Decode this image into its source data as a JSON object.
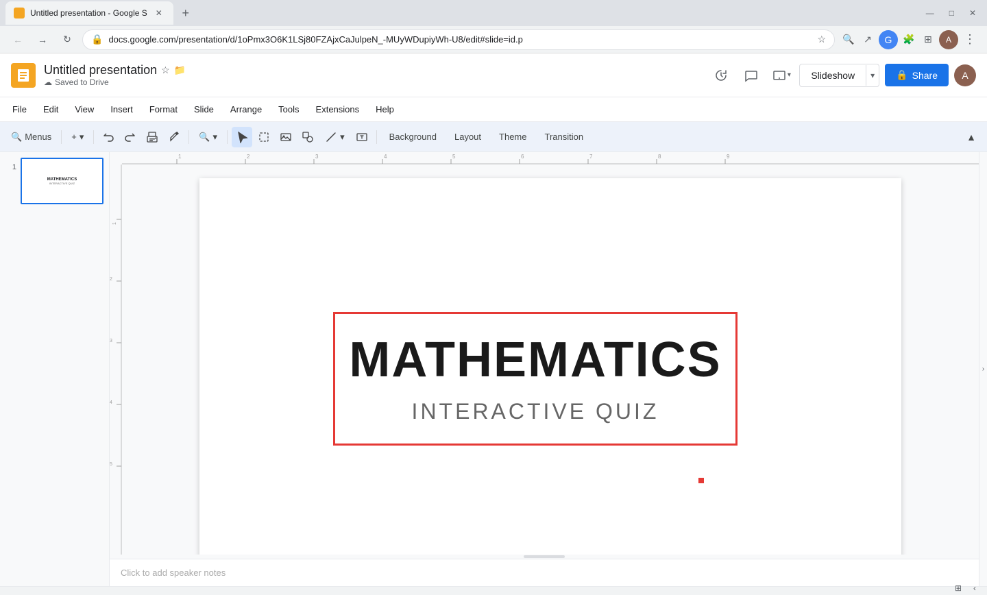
{
  "browser": {
    "tab_title": "Untitled presentation - Google S",
    "url": "docs.google.com/presentation/d/1oPmx3O6K1LSj80FZAjxCaJulpeN_-MUyWDupiyWh-U8/edit#slide=id.p",
    "new_tab_label": "+",
    "favicon_color": "#f4a522"
  },
  "app": {
    "logo_char": "▶",
    "title": "Untitled presentation",
    "star_icon": "★",
    "folder_icon": "📁",
    "cloud_save_text": "Saved to Drive",
    "cloud_icon": "☁"
  },
  "header_icons": {
    "history_icon": "🕐",
    "comment_icon": "💬",
    "cast_icon": "🖥",
    "cast_dropdown": "▾"
  },
  "slideshow": {
    "label": "Slideshow",
    "dropdown_char": "▾"
  },
  "share": {
    "label": "Share",
    "icon": "👤"
  },
  "menu_items": [
    "File",
    "Edit",
    "View",
    "Insert",
    "Format",
    "Slide",
    "Arrange",
    "Tools",
    "Extensions",
    "Help"
  ],
  "toolbar": {
    "menus_label": "Menus",
    "search_icon": "🔍",
    "add_icon": "+",
    "add_dropdown": "▾",
    "undo_icon": "↶",
    "redo_icon": "↷",
    "print_icon": "🖨",
    "paint_icon": "🎨",
    "zoom_icon": "🔍",
    "zoom_dropdown": "▾",
    "cursor_icon": "↖",
    "marquee_icon": "⬚",
    "image_icon": "🖼",
    "shapes_icon": "⬡",
    "line_icon": "╱",
    "line_dropdown": "▾",
    "textbox_icon": "T",
    "background_label": "Background",
    "layout_label": "Layout",
    "theme_label": "Theme",
    "transition_label": "Transition",
    "collapse_icon": "▲"
  },
  "slide_panel": {
    "slide_number": "1"
  },
  "slide": {
    "main_title": "MATHEMATICS",
    "subtitle": "INTERACTIVE QUIZ",
    "border_color": "#e53935",
    "title_color": "#1a1a1a",
    "subtitle_color": "#666666"
  },
  "speaker_notes": {
    "placeholder": "Click to add speaker notes"
  }
}
